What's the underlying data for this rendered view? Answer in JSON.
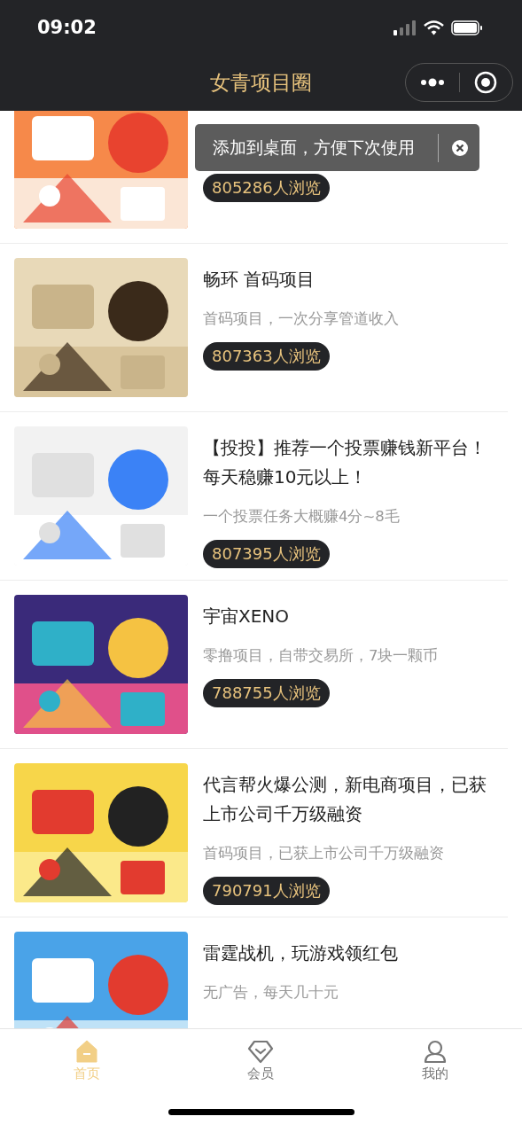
{
  "status_bar": {
    "time": "09:02"
  },
  "nav_bar": {
    "title": "女青项目圈"
  },
  "tooltip": {
    "text": "添加到桌面，方便下次使用"
  },
  "items": [
    {
      "views": "805286人浏览"
    },
    {
      "title": "畅环 首码项目",
      "subtitle": "首码项目，一次分享管道收入",
      "views": "807363人浏览"
    },
    {
      "title": "【投投】推荐一个投票赚钱新平台！每天稳赚10元以上！",
      "subtitle": "一个投票任务大概赚4分~8毛",
      "views": "807395人浏览"
    },
    {
      "title": "宇宙XENO",
      "subtitle": "零撸项目，自带交易所，7块一颗币",
      "views": "788755人浏览"
    },
    {
      "title": "代言帮火爆公测，新电商项目，已获上市公司千万级融资",
      "subtitle": "首码项目，已获上市公司千万级融资",
      "views": "790791人浏览"
    },
    {
      "title": "雷霆战机，玩游戏领红包",
      "subtitle": "无广告，每天几十元"
    }
  ],
  "tab_bar": [
    {
      "label": "首页",
      "kind": "home",
      "selected": true
    },
    {
      "label": "会员",
      "kind": "member",
      "selected": false
    },
    {
      "label": "我的",
      "kind": "profile",
      "selected": false
    }
  ]
}
